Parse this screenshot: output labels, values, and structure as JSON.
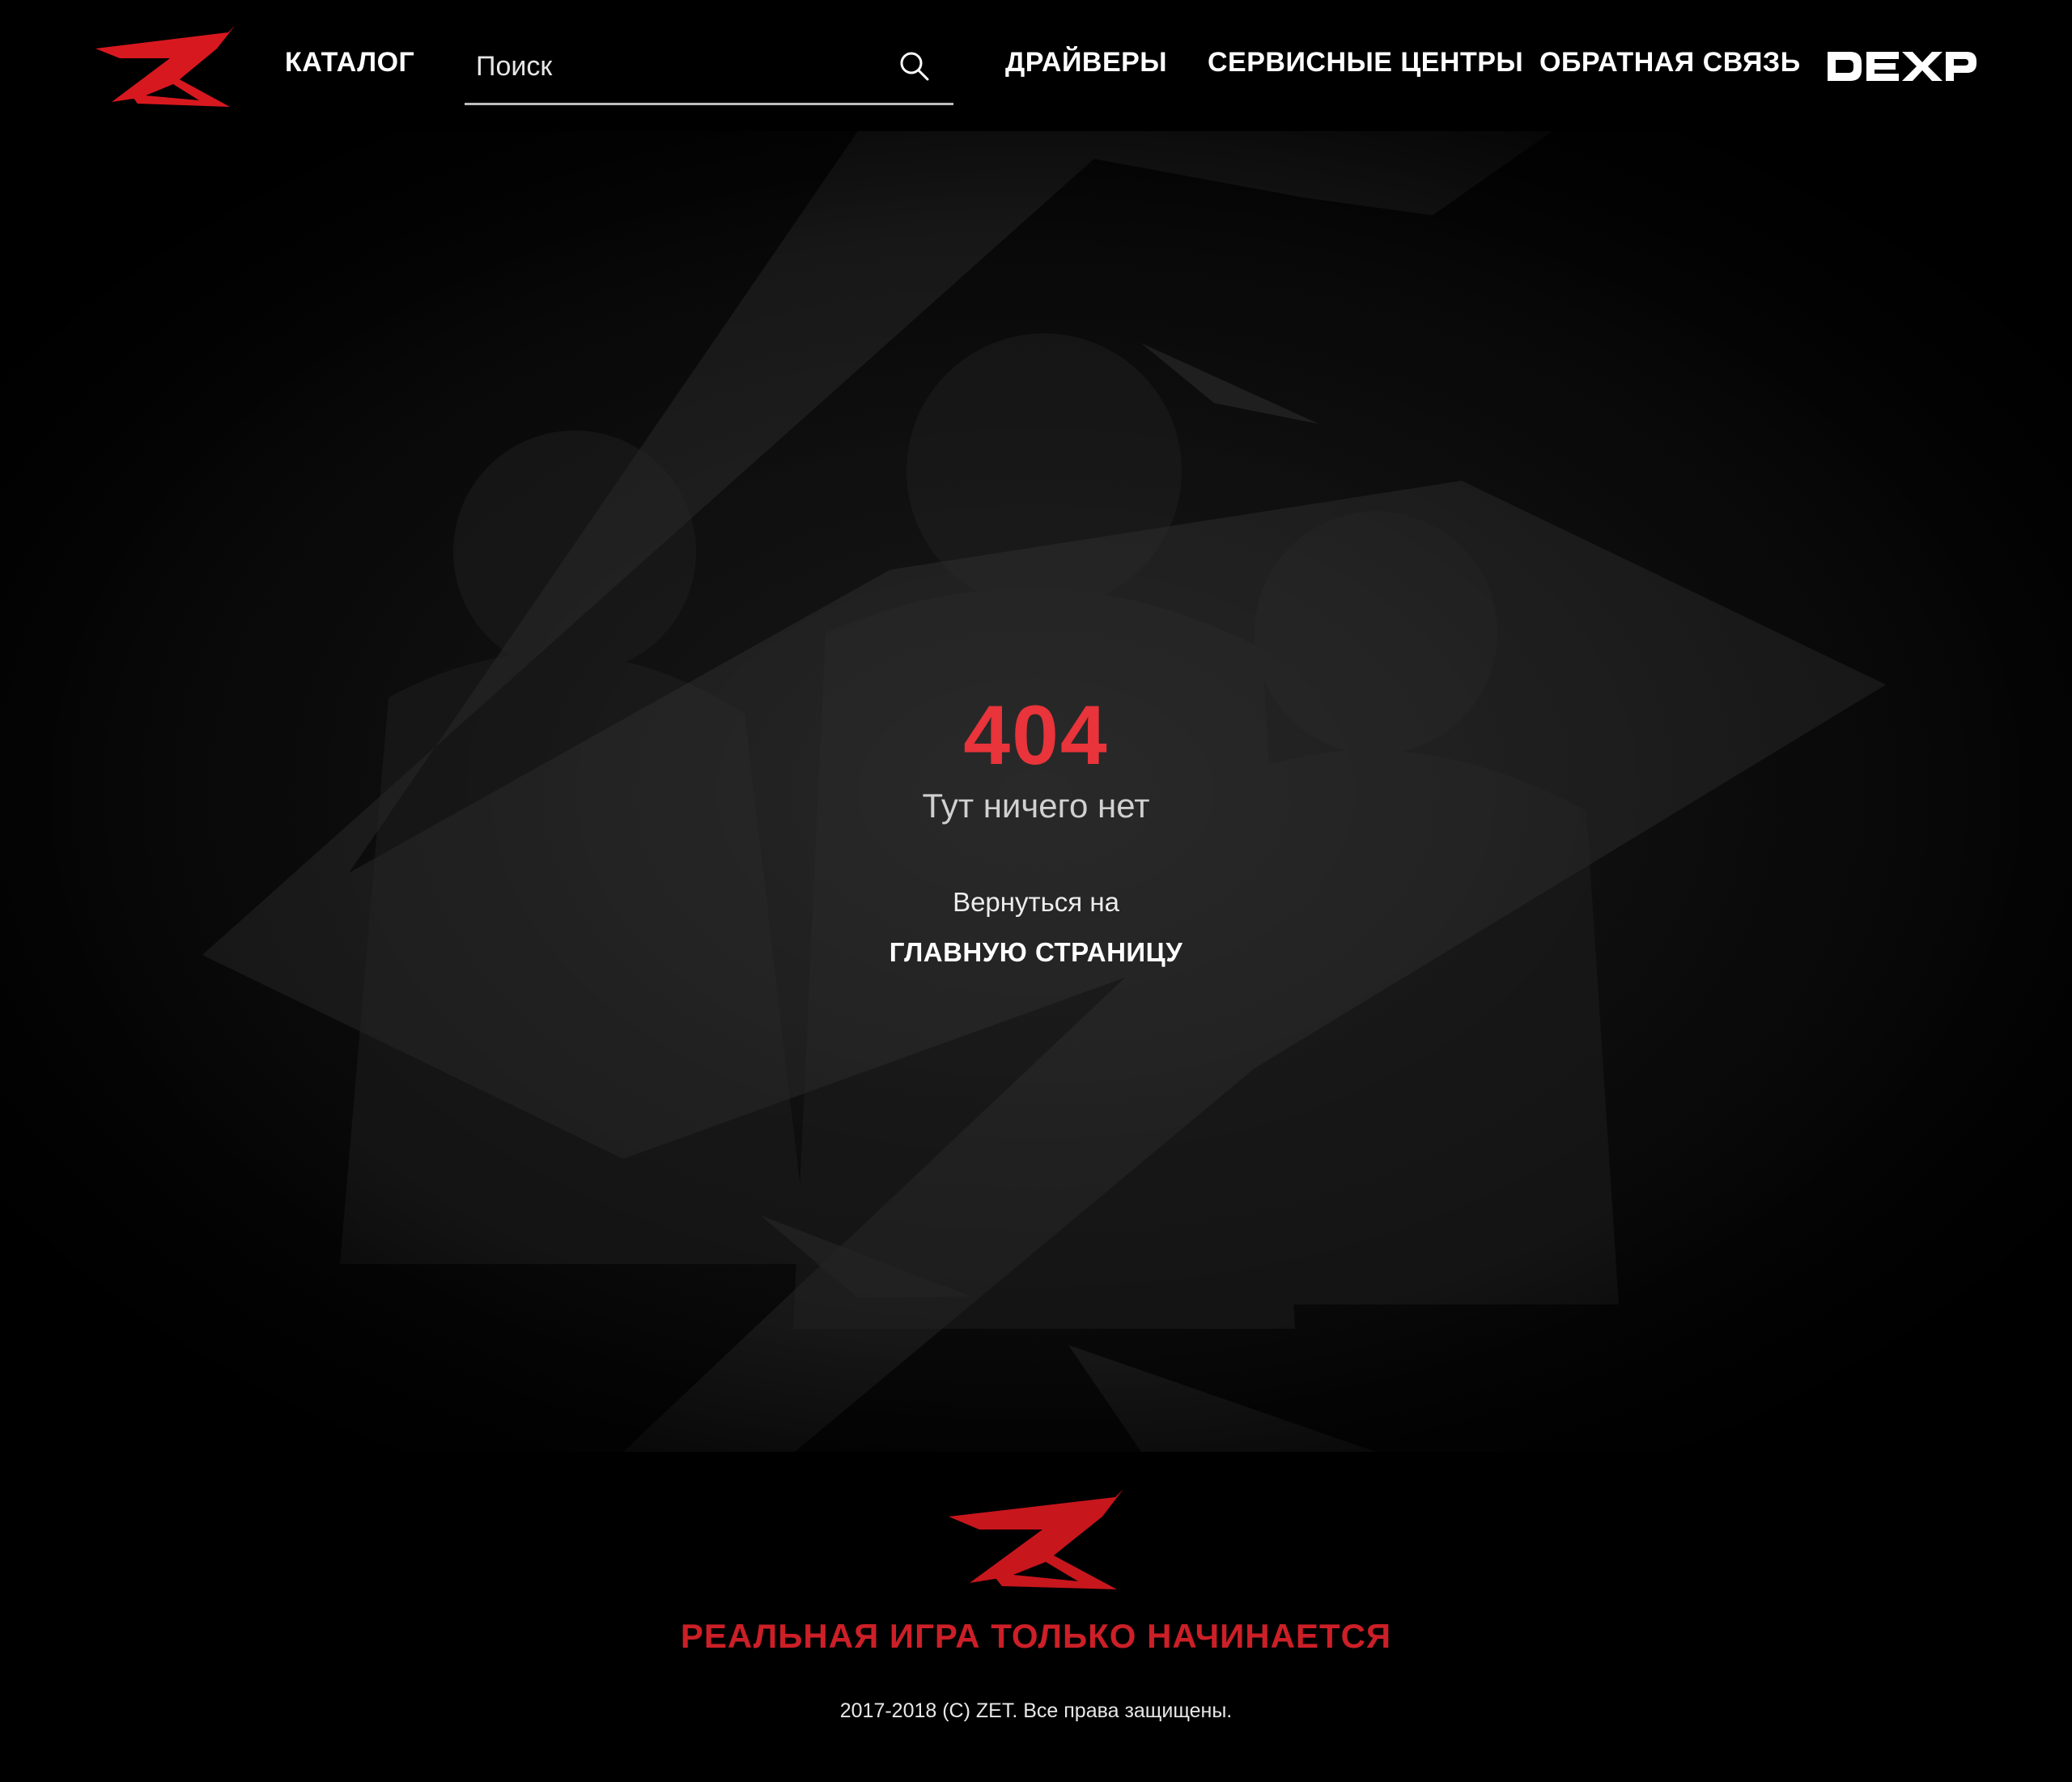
{
  "header": {
    "catalog_label": "КАТАЛОГ",
    "search_placeholder": "Поиск",
    "search_value": "",
    "nav": {
      "drivers": "ДРАЙВЕРЫ",
      "service_centers": "СЕРВИСНЫЕ ЦЕНТРЫ",
      "feedback": "ОБРАТНАЯ СВЯЗЬ"
    },
    "partner_logo": "DEXP",
    "icons": {
      "logo": "zet-z-logo",
      "search": "search-icon"
    }
  },
  "error": {
    "code": "404",
    "message": "Тут ничего нет",
    "back_text": "Вернуться на",
    "home_link": "ГЛАВНУЮ СТРАНИЦУ"
  },
  "footer": {
    "slogan": "РЕАЛЬНАЯ ИГРА ТОЛЬКО НАЧИНАЕТСЯ",
    "copyright": "2017-2018 (C) ZET. Все права защищены."
  },
  "colors": {
    "background": "#000000",
    "accent_red": "#e8343a",
    "brand_red": "#cc1f27",
    "text_white": "#ffffff"
  }
}
